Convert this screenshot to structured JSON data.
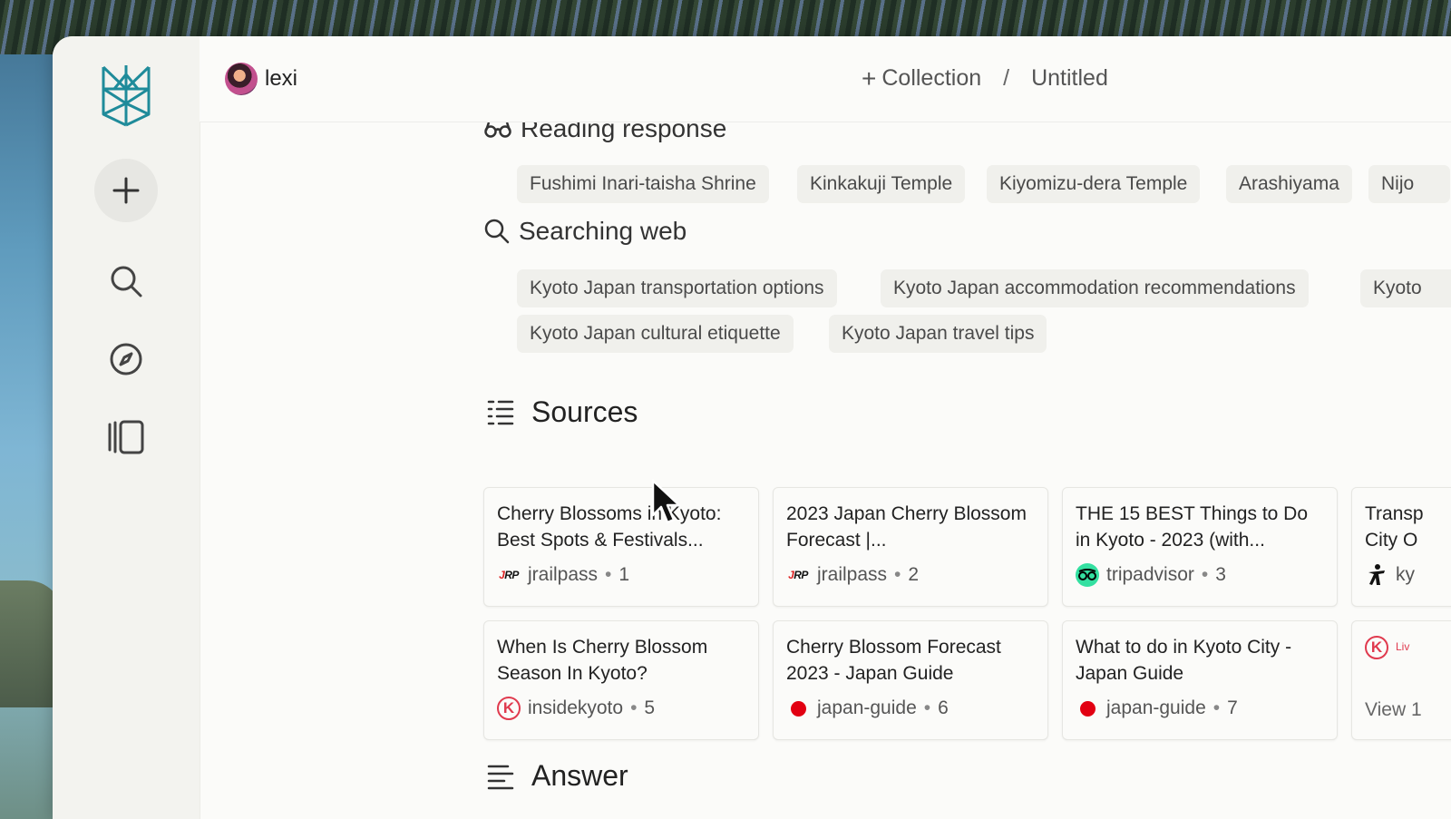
{
  "header": {
    "username": "lexi",
    "collection_label": "Collection",
    "separator": "/",
    "thread_title": "Untitled"
  },
  "steps": {
    "reading": {
      "title": "Reading response",
      "chips": [
        "Fushimi Inari-taisha Shrine",
        "Kinkakuji Temple",
        "Kiyomizu-dera Temple",
        "Arashiyama",
        "Nijo"
      ]
    },
    "searching": {
      "title": "Searching web",
      "chips": [
        "Kyoto Japan transportation options",
        "Kyoto Japan accommodation recommendations",
        "Kyoto",
        "Kyoto Japan cultural etiquette",
        "Kyoto Japan travel tips"
      ]
    }
  },
  "sources": {
    "title": "Sources",
    "cards": [
      {
        "title": "Cherry Blossoms in Kyoto: Best Spots & Festivals...",
        "site": "jrailpass",
        "index": "1",
        "favicon": "jrp"
      },
      {
        "title": "2023 Japan Cherry Blossom Forecast |...",
        "site": "jrailpass",
        "index": "2",
        "favicon": "jrp"
      },
      {
        "title": "THE 15 BEST Things to Do in Kyoto - 2023 (with...",
        "site": "tripadvisor",
        "index": "3",
        "favicon": "tripadvisor"
      },
      {
        "title": "Transp City O",
        "site": "ky",
        "index": "",
        "favicon": "kyoto-figure"
      },
      {
        "title": "When Is Cherry Blossom Season In Kyoto?",
        "site": "insidekyoto",
        "index": "5",
        "favicon": "k"
      },
      {
        "title": "Cherry Blossom Forecast 2023 - Japan Guide",
        "site": "japan-guide",
        "index": "6",
        "favicon": "japan-guide"
      },
      {
        "title": "What to do in Kyoto City - Japan Guide",
        "site": "japan-guide",
        "index": "7",
        "favicon": "japan-guide"
      },
      {
        "title": "Liv",
        "site": "View 1",
        "index": "",
        "favicon": "k"
      }
    ]
  },
  "answer": {
    "title": "Answer"
  },
  "colors": {
    "accent": "#1f8b9a",
    "japan_guide_red": "#e20012",
    "tripadvisor_green": "#34e0a1"
  }
}
